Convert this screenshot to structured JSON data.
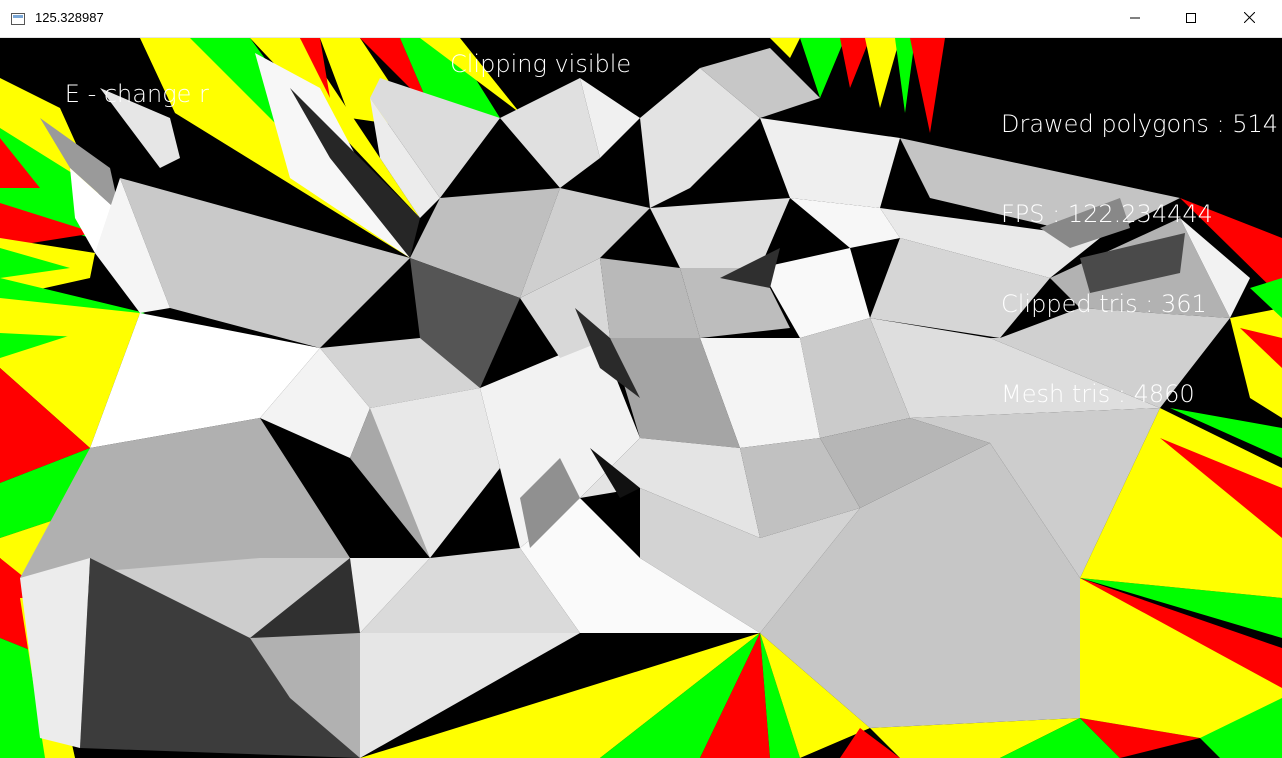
{
  "window": {
    "title": "125.328987",
    "controls": {
      "minimize": "minimize",
      "maximize": "maximize",
      "close": "close"
    }
  },
  "hud": {
    "left_partial": "E - change r",
    "left_status": "Clipping visible",
    "stats": [
      "Drawed polygons : 514",
      "FPS : 122.234444",
      "Clipped tris : 361",
      "Mesh tris : 4860"
    ]
  },
  "colors": {
    "background": "#000000",
    "clip_red": "#ff0000",
    "clip_green": "#00ff00",
    "clip_yellow": "#ffff00",
    "mesh_light": "#f2f2f2",
    "mesh_mid": "#b5b5b5",
    "mesh_dark": "#3c3c3c"
  }
}
